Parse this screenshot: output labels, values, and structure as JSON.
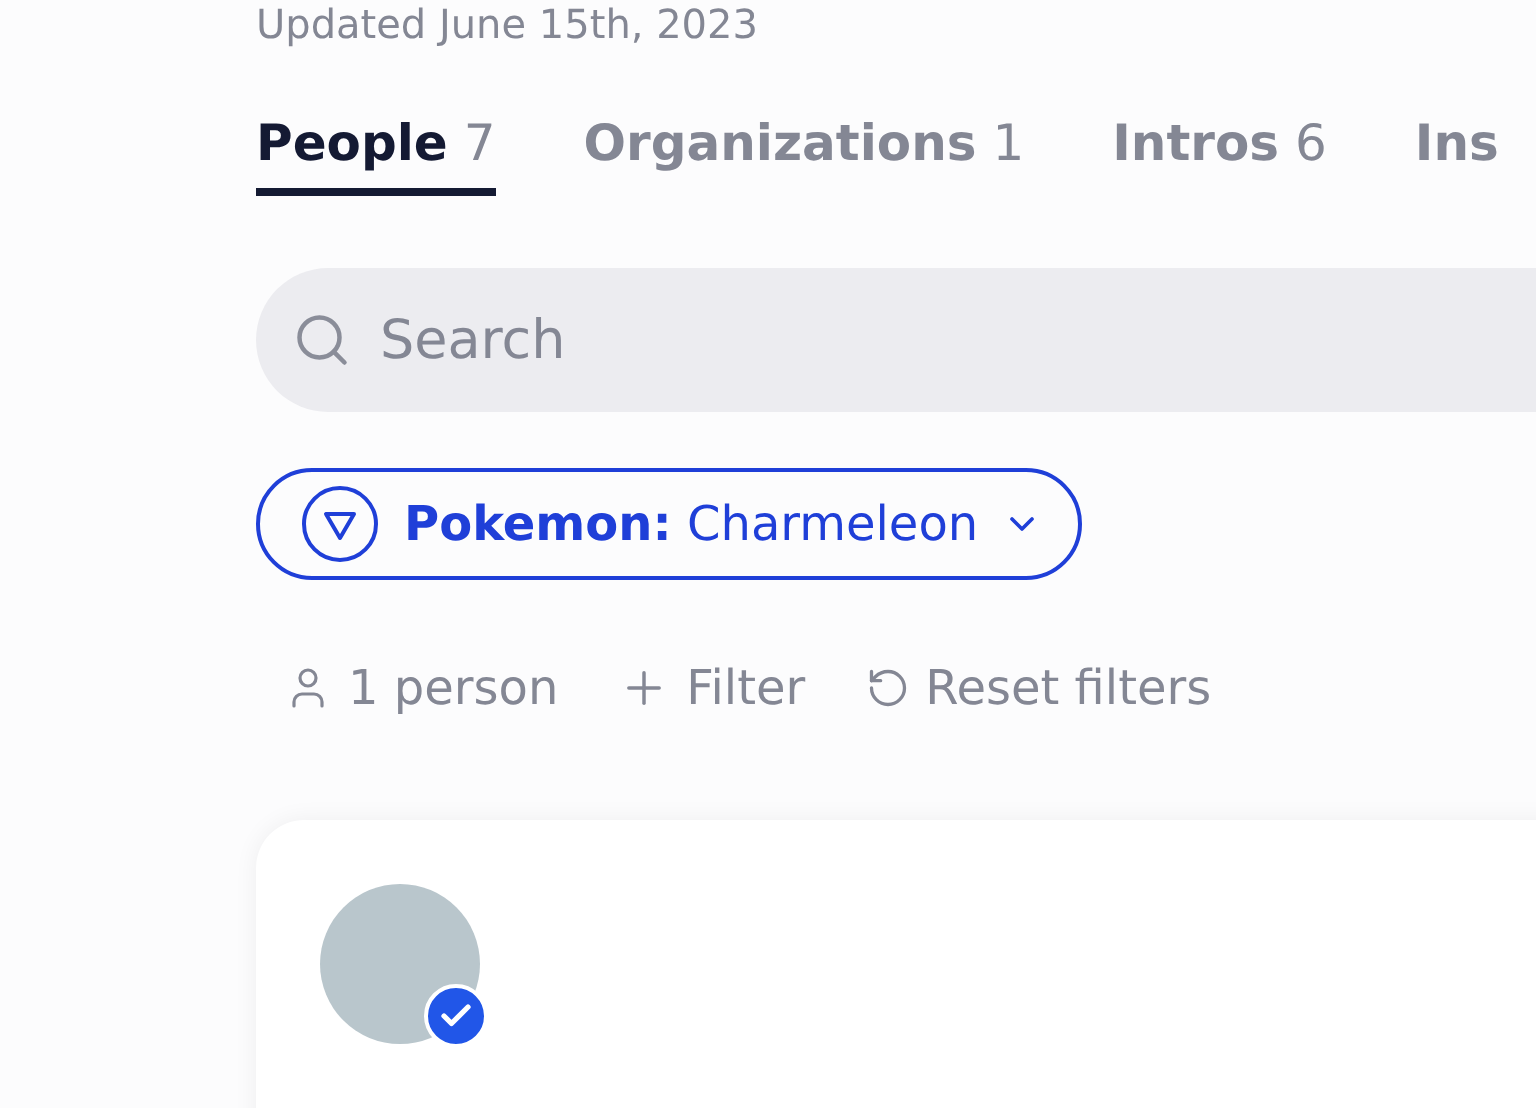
{
  "updated": "Updated June 15th, 2023",
  "tabs": [
    {
      "label": "People",
      "count": "7",
      "selected": true
    },
    {
      "label": "Organizations",
      "count": "1",
      "selected": false
    },
    {
      "label": "Intros",
      "count": "6",
      "selected": false
    },
    {
      "label": "Ins",
      "selected": false
    }
  ],
  "search": {
    "placeholder": "Search"
  },
  "filter_chip": {
    "label": "Pokemon:",
    "value": "Charmeleon"
  },
  "actions": [
    {
      "kind": "count",
      "text": "1 person"
    },
    {
      "kind": "add",
      "text": "Filter"
    },
    {
      "kind": "reset",
      "text": "Reset filters"
    }
  ],
  "person_card": {
    "verified": true
  }
}
